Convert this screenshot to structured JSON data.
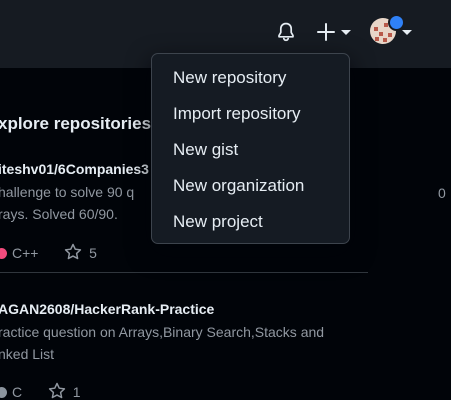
{
  "header": {
    "bell_icon": "bell-icon",
    "create_icon": "plus-icon",
    "avatar_status_color": "#2f81f7"
  },
  "create_menu": {
    "items": [
      {
        "label": "New repository"
      },
      {
        "label": "Import repository"
      },
      {
        "label": "New gist"
      },
      {
        "label": "New organization"
      },
      {
        "label": "New project"
      }
    ]
  },
  "explore": {
    "title": "xplore repositories",
    "repos": [
      {
        "name": "iteshv01/6Companies3",
        "desc_line1": "hallenge to solve 90 q",
        "desc_line1_tail": "0",
        "desc_line2": "rays. Solved 60/90.",
        "language": "C++",
        "language_color": "#f34b7d",
        "stars": "5"
      },
      {
        "name": "AGAN2608/HackerRank-Practice",
        "desc_line1": "ractice question on Arrays,Binary Search,Stacks and",
        "desc_line2": "nked List",
        "language": "C",
        "language_color": "#555555",
        "stars": "1"
      }
    ]
  }
}
